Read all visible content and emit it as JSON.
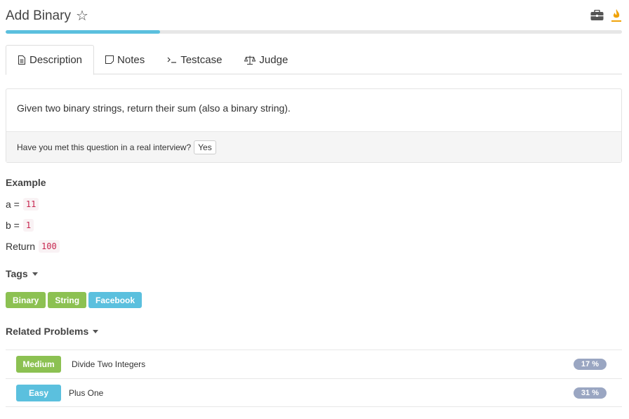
{
  "header": {
    "title": "Add Binary",
    "progress_fraction": 0.25,
    "progress_color": "#5bc0de",
    "icons": [
      "star-icon",
      "briefcase-icon",
      "flame-icon"
    ]
  },
  "tabs": [
    {
      "label": "Description",
      "icon": "document-icon",
      "active": true
    },
    {
      "label": "Notes",
      "icon": "note-icon",
      "active": false
    },
    {
      "label": "Testcase",
      "icon": "terminal-icon",
      "active": false
    },
    {
      "label": "Judge",
      "icon": "scale-icon",
      "active": false
    }
  ],
  "description": {
    "text": "Given two binary strings, return their sum (also a binary string).",
    "interview_question": "Have you met this question in a real interview?",
    "yes_label": "Yes"
  },
  "example": {
    "heading": "Example",
    "a_label": "a =",
    "a_value": "11",
    "b_label": "b =",
    "b_value": "1",
    "return_label": "Return",
    "return_value": "100"
  },
  "tags": {
    "heading": "Tags",
    "items": [
      {
        "label": "Binary",
        "color": "#8cc152"
      },
      {
        "label": "String",
        "color": "#8cc152"
      },
      {
        "label": "Facebook",
        "color": "#5bc0de"
      }
    ]
  },
  "related": {
    "heading": "Related Problems",
    "items": [
      {
        "difficulty": "Medium",
        "difficulty_color": "#8cc152",
        "title": "Divide Two Integers",
        "percent": "17 %"
      },
      {
        "difficulty": "Easy",
        "difficulty_color": "#5bc0de",
        "title": "Plus One",
        "percent": "31 %"
      }
    ]
  }
}
